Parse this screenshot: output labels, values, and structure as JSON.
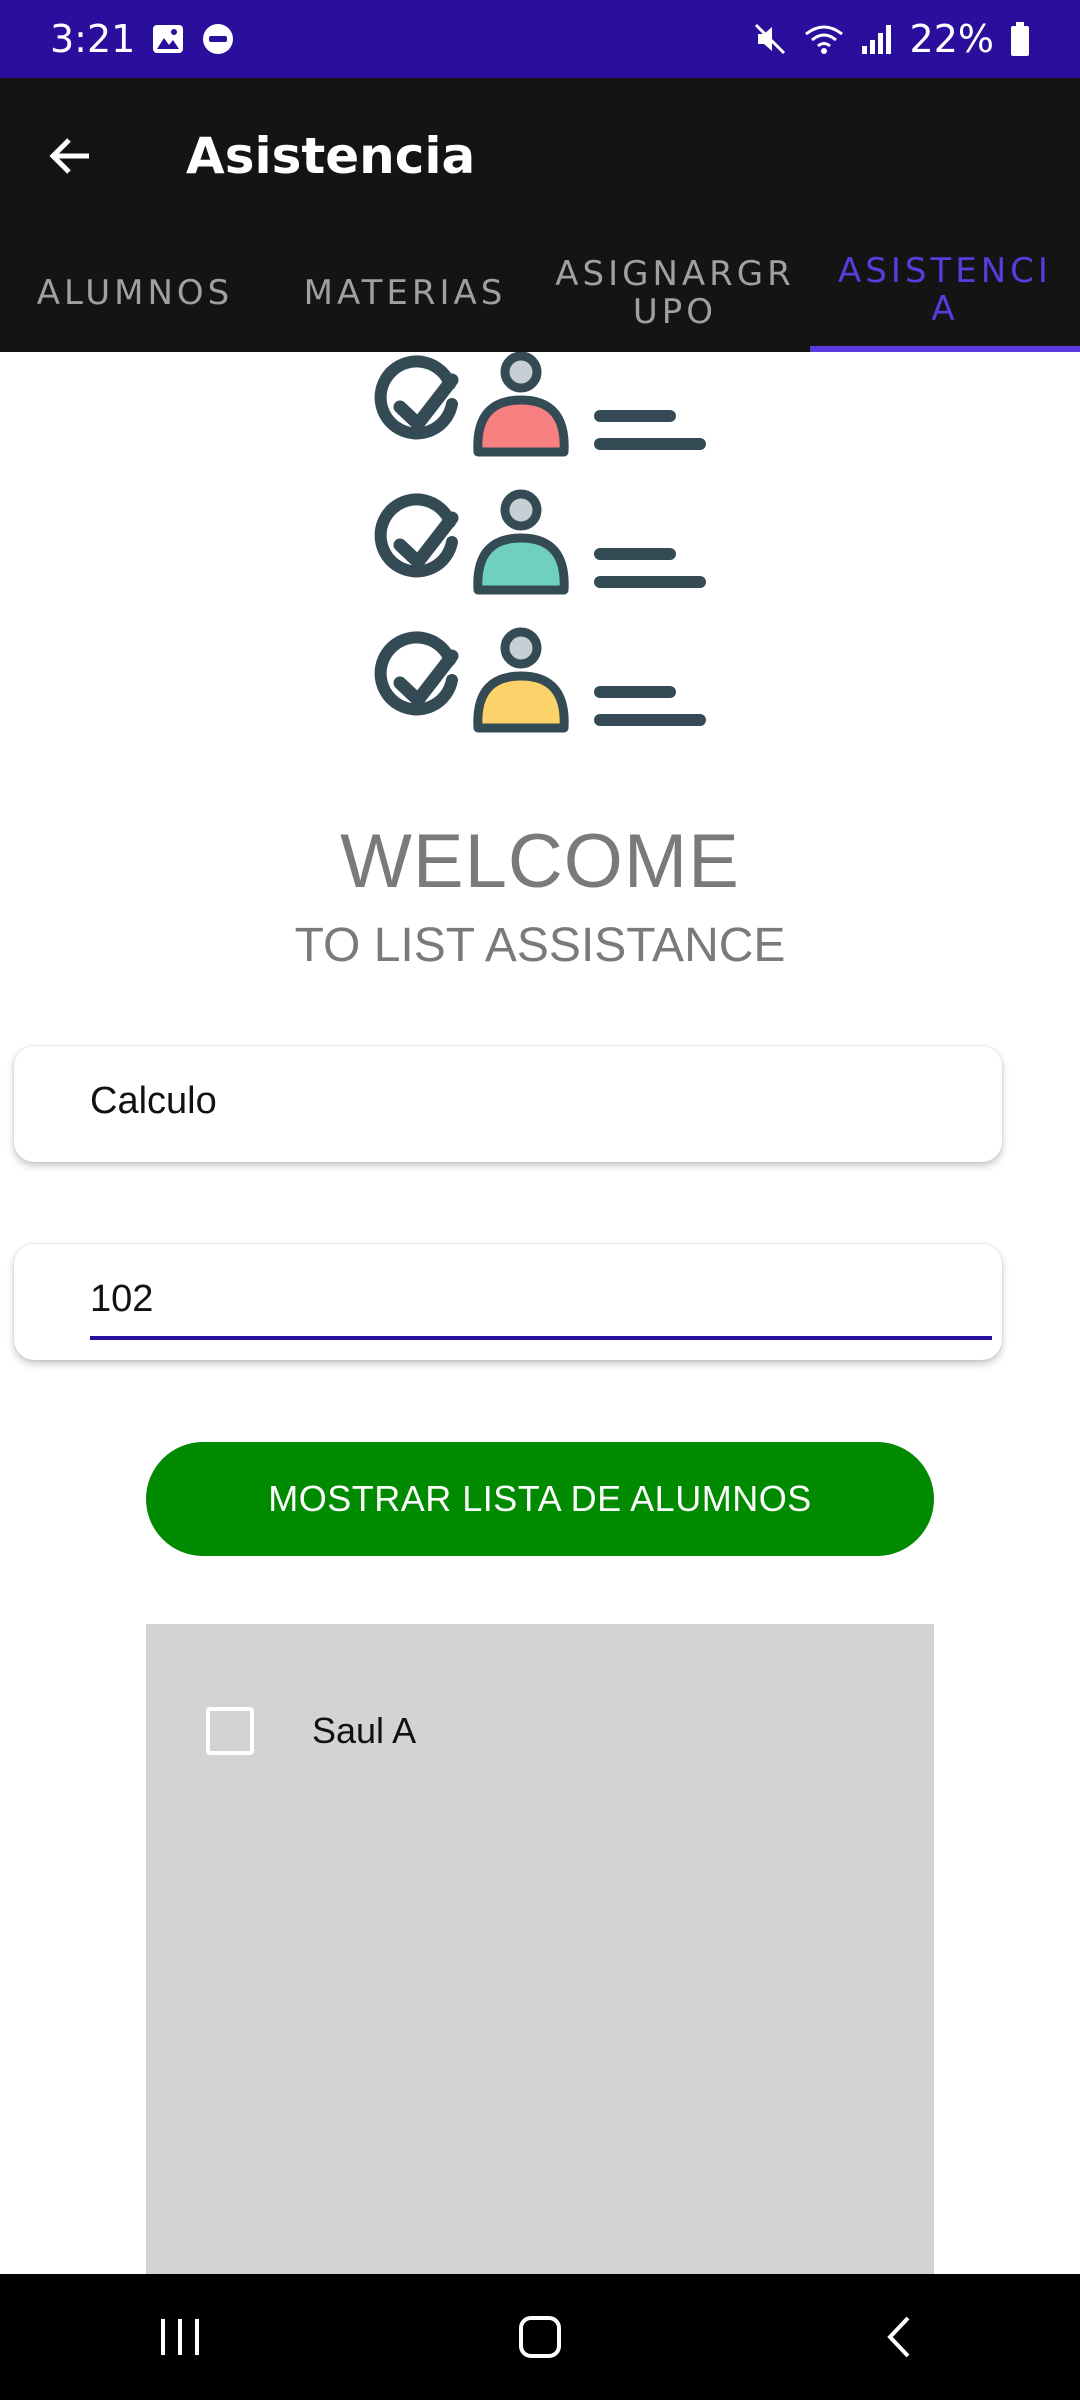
{
  "status_bar": {
    "time": "3:21",
    "battery": "22%",
    "background": "#2a0f9d"
  },
  "app_bar": {
    "title": "Asistencia"
  },
  "tabs": [
    {
      "label": "ALUMNOS",
      "active": false
    },
    {
      "label": "MATERIAS",
      "active": false
    },
    {
      "label": "ASIGNARGR\nUPO",
      "active": false
    },
    {
      "label": "ASISTENCI\nA",
      "active": true
    }
  ],
  "welcome": {
    "title": "WELCOME",
    "subtitle": "TO LIST ASSISTANCE"
  },
  "form": {
    "subject_value": "Calculo",
    "group_value": "102"
  },
  "button": {
    "label": "MOSTRAR LISTA DE ALUMNOS",
    "color": "#008a00"
  },
  "student_list": [
    {
      "name": "Saul A",
      "checked": false
    }
  ],
  "colors": {
    "accent": "#5b3be0",
    "app_bar": "#141414",
    "list_bg": "#d3d3d3",
    "person_red": "#f98080",
    "person_teal": "#6fd0bd",
    "person_yellow": "#fcd36b",
    "icon_dark": "#344a55"
  }
}
